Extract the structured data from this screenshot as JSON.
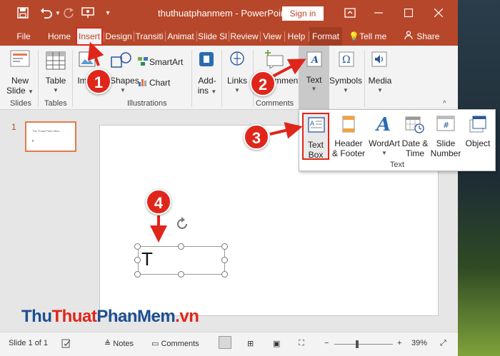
{
  "app": {
    "title": "thuthuatphanmem  -  PowerPoint",
    "signin_label": "Sign in",
    "accent": "#b7472a"
  },
  "tabs": [
    {
      "label": "File"
    },
    {
      "label": "Home"
    },
    {
      "label": "Insert",
      "active": true
    },
    {
      "label": "Design"
    },
    {
      "label": "Transiti"
    },
    {
      "label": "Animat"
    },
    {
      "label": "Slide Sl"
    },
    {
      "label": "Review"
    },
    {
      "label": "View"
    },
    {
      "label": "Help"
    },
    {
      "label": "Format"
    },
    {
      "label": "Tell me"
    },
    {
      "label": "Share"
    }
  ],
  "ribbon": {
    "new_slide": {
      "line1": "New",
      "line2": "Slide"
    },
    "table": "Table",
    "images": "Im",
    "shapes": "Shapes",
    "smartart": "SmartArt",
    "chart": "Chart",
    "addins": {
      "line1": "Add-",
      "line2": "ins"
    },
    "links": "Links",
    "comment": "mment",
    "text": "Text",
    "symbols": "Symbols",
    "media": "Media",
    "groups": {
      "slides": "Slides",
      "tables": "Tables",
      "illustrations": "Illustrations",
      "comments": "Comments"
    }
  },
  "text_dropdown": {
    "items": [
      {
        "line1": "Text",
        "line2": "Box"
      },
      {
        "line1": "Header",
        "line2": "& Footer"
      },
      {
        "line1": "WordArt",
        "line2": ""
      },
      {
        "line1": "Date &",
        "line2": "Time"
      },
      {
        "line1": "Slide",
        "line2": "Number"
      },
      {
        "line1": "Object",
        "line2": ""
      }
    ],
    "group_label": "Text"
  },
  "slides": {
    "number": "1",
    "thumb_text": "Thu Thuat Phan Mem"
  },
  "textbox": {
    "content": "T"
  },
  "status": {
    "slide_count": "Slide 1 of 1",
    "notes": "Notes",
    "comments": "Comments",
    "zoom": "39%"
  },
  "annotations": [
    "1",
    "2",
    "3",
    "4"
  ],
  "watermark": {
    "a": "Thu",
    "b": "Thuat",
    "c": "PhanMem",
    "d": ".vn"
  }
}
